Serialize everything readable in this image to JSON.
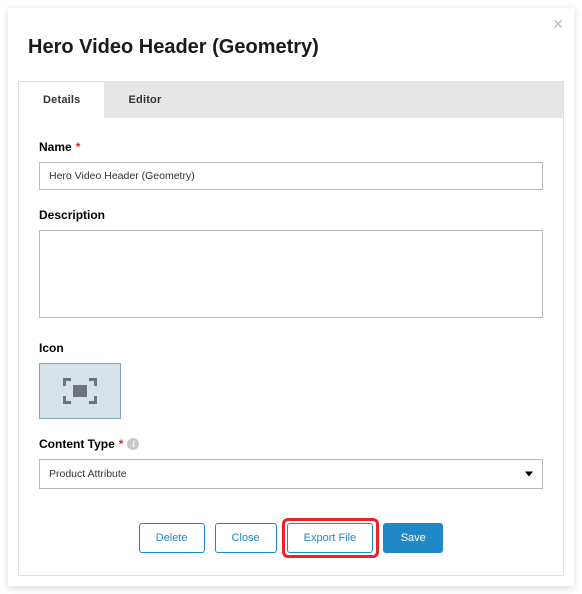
{
  "modal": {
    "title": "Hero Video Header (Geometry)",
    "close_glyph": "✕"
  },
  "tabs": [
    {
      "label": "Details",
      "active": true
    },
    {
      "label": "Editor",
      "active": false
    }
  ],
  "fields": {
    "name": {
      "label": "Name",
      "required": true,
      "value": "Hero Video Header (Geometry)"
    },
    "description": {
      "label": "Description",
      "value": ""
    },
    "icon": {
      "label": "Icon"
    },
    "content_type": {
      "label": "Content Type",
      "required": true,
      "value": "Product Attribute"
    }
  },
  "buttons": {
    "delete": "Delete",
    "close": "Close",
    "export": "Export File",
    "save": "Save"
  },
  "required_glyph": "*"
}
